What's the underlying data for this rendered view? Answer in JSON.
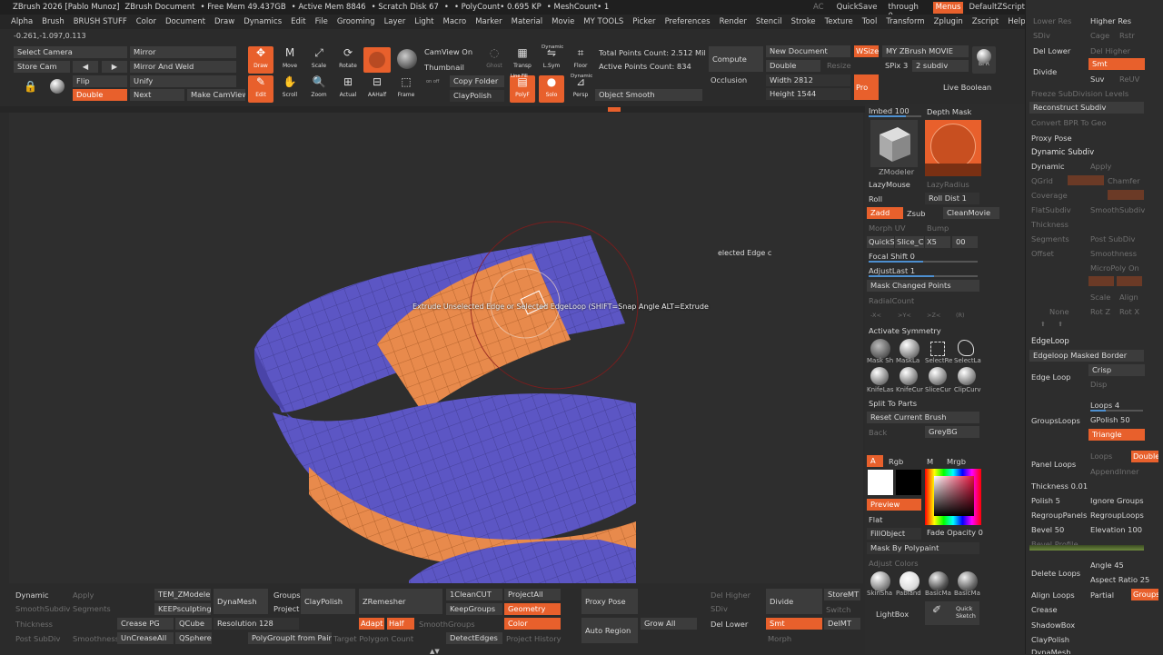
{
  "titlebar": {
    "items": [
      "ZBrush 2026 [Pablo Munoz]",
      "ZBrush Document",
      "• Free Mem 49.437GB",
      "• Active Mem 8846",
      "• Scratch Disk 67",
      "•",
      "• PolyCount• 0.695 KP",
      "• MeshCount• 1"
    ]
  },
  "top_right": {
    "ac": "AC",
    "quicksave": "QuickSave",
    "seethrough": "See-through 0",
    "menus": "Menus",
    "script": "DefaultZScript"
  },
  "menu": [
    "Alpha",
    "Brush",
    "BRUSH STUFF",
    "Color",
    "Document",
    "Draw",
    "Dynamics",
    "Edit",
    "File",
    "Grooming",
    "Layer",
    "Light",
    "Macro",
    "Marker",
    "Material",
    "Movie",
    "MY TOOLS",
    "Picker",
    "Preferences",
    "Render",
    "Stencil",
    "Stroke",
    "Texture",
    "Tool",
    "Transform",
    "Zplugin",
    "Zscript",
    "Help"
  ],
  "coords": "-0.261,-1.097,0.113",
  "toolbar": {
    "select_camera": "Select Camera",
    "mirror": "Mirror",
    "store_cam": "Store Cam",
    "mirror_weld": "Mirror And Weld",
    "flip": "Flip",
    "unify": "Unify",
    "double": "Double",
    "next": "Next",
    "make_camview": "Make CamView",
    "draw": "Draw",
    "move": "Move",
    "scale": "Scale",
    "rotate": "Rotate",
    "edit": "Edit",
    "scroll": "Scroll",
    "zoom": "Zoom",
    "actual": "Actual",
    "aahalf": "AAHalf",
    "frame": "Frame",
    "camview_on": "CamView On",
    "thumbnail": "Thumbnail",
    "copy_folder": "Copy Folder",
    "claypolish": "ClayPolish",
    "on_off": "on   off",
    "ghost": "Ghost",
    "transp": "Transp",
    "lsym": "L.Sym",
    "floor": "Floor",
    "dynamic": "Dynamic",
    "polyf": "PolyF",
    "solo": "Solo",
    "persp": "Persp",
    "linefill": "Line Fill",
    "dynamic2": "Dynamic",
    "total_points": "Total Points Count: 2.512 Mil",
    "active_points": "Active Points Count: 834",
    "object_smooth": "Object Smooth",
    "compute": "Compute",
    "occlusion": "Occlusion",
    "new_document": "New Document",
    "double2": "Double",
    "resize": "Resize",
    "width": "Width 2812",
    "height": "Height 1544",
    "wsize": "WSize",
    "pro": "Pro",
    "my_zbrush_movie": "MY ZBrush MOVIE",
    "spix": "SPix 3",
    "subdiv": "2 subdiv",
    "bpr": "BPR",
    "live_boolean": "Live Boolean"
  },
  "viewport": {
    "tooltip": "Extrude Unselected Edge or Selected EdgeLoop (SHIFT=Snap Angle  ALT=Extrude",
    "side_text": "elected Edge c"
  },
  "rpanel": {
    "imbed": "Imbed 100",
    "depth_mask": "Depth Mask",
    "zmodeler": "ZModeler",
    "lazymouse": "LazyMouse",
    "lazyradius": "LazyRadius",
    "roll": "Roll",
    "roll_dist": "Roll Dist 1",
    "zadd": "Zadd",
    "zsub": "Zsub",
    "cleanmovie": "CleanMovie",
    "morph_uv": "Morph UV",
    "bump": "Bump",
    "quicksc": "QuickSc",
    "slice": "Slice_Cu",
    "x5": "X5",
    "oo": "00",
    "focal_shift": "Focal Shift 0",
    "adjustlast": "AdjustLast 1",
    "mask_changed": "Mask Changed Points",
    "radialcount": "RadialCount",
    "axes": [
      "-X<",
      ">Y<",
      ">Z<",
      "(R)"
    ],
    "activate_symmetry": "Activate Symmetry",
    "brush_labels": [
      "Mask Sh",
      "MaskLa",
      "SelectRe",
      "SelectLa"
    ],
    "brush_labels2": [
      "KnifeLas",
      "KnifeCur",
      "SliceCur",
      "ClipCurv"
    ],
    "split_to_parts": "Split To Parts",
    "reset_brush": "Reset Current Brush",
    "back": "Back",
    "greybg": "GreyBG",
    "a": "A",
    "rgb": "Rgb",
    "m": "M",
    "mrgb": "Mrgb",
    "preview": "Preview",
    "flat": "Flat",
    "fillobject": "FillObject",
    "fade_opacity": "Fade Opacity 0",
    "mask_polypaint": "Mask By Polypaint",
    "adjust_colors": "Adjust Colors",
    "mat_labels": [
      "SkinSha",
      "Pabland",
      "BasicMa",
      "BasicMa"
    ],
    "lightbox": "LightBox",
    "quick_sketch": "Quick Sketch"
  },
  "bottom": {
    "dynamic": "Dynamic",
    "apply": "Apply",
    "smoothsubdiv": "SmoothSubdiv",
    "segments": "Segments",
    "thickness": "Thickness",
    "post_subdiv": "Post SubDiv",
    "smoothness": "Smoothness",
    "tem_zmodeler": "TEM_ZModeler",
    "keepsculpting": "KEEPsculpting",
    "crease_pg": "Crease PG",
    "qcube": "QCube",
    "uncreaseall": "UnCreaseAll",
    "qsphere": "QSphere",
    "dynamesh": "DynaMesh",
    "resolution": "Resolution 128",
    "groups": "Groups",
    "project": "Project",
    "claypolish": "ClayPolish",
    "polygroupit": "PolyGroupIt from Paint",
    "zremesher": "ZRemesher",
    "adapt": "Adapt",
    "half": "Half",
    "smoothgroups": "SmoothGroups",
    "target_poly": "Target Polygon Count",
    "cleancut": "1CleanCUT",
    "keepgroups": "KeepGroups",
    "detectedges": "DetectEdges",
    "projectall": "ProjectAll",
    "geometry": "Geometry",
    "color": "Color",
    "project_history": "Project History",
    "proxy_pose": "Proxy Pose",
    "auto_region": "Auto Region",
    "grow_all": "Grow All",
    "del_higher": "Del Higher",
    "sdiv": "SDiv",
    "del_lower": "Del Lower",
    "divide": "Divide",
    "smt": "Smt",
    "storemt": "StoreMT",
    "switch": "Switch",
    "delmt": "DelMT",
    "morph": "Morph"
  },
  "farright": {
    "lower_res": "Lower Res",
    "higher_res": "Higher Res",
    "sdiv": "SDiv",
    "cage": "Cage",
    "rstr": "Rstr",
    "del_lower": "Del Lower",
    "del_higher": "Del Higher",
    "divide": "Divide",
    "smt": "Smt",
    "suv": "Suv",
    "reuv": "ReUV",
    "freeze": "Freeze SubDivision Levels",
    "reconstruct": "Reconstruct Subdiv",
    "convert_bpr": "Convert BPR To Geo",
    "proxy_pose": "Proxy Pose",
    "dynamic_subdiv": "Dynamic Subdiv",
    "dynamic": "Dynamic",
    "apply": "Apply",
    "qgrid": "QGrid",
    "chamfer": "Chamfer",
    "coverage": "Coverage",
    "flatsubdiv": "FlatSubdiv",
    "smoothsubdiv": "SmoothSubdiv",
    "thickness": "Thickness",
    "segments": "Segments",
    "post_subdiv": "Post SubDiv",
    "offset": "Offset",
    "smoothness": "Smoothness",
    "micropoly": "MicroPoly On",
    "scale": "Scale",
    "align": "Align",
    "none": "None",
    "rot_z": "Rot Z",
    "rot_x": "Rot X",
    "edgeloop": "EdgeLoop",
    "edgeloop_masked": "Edgeloop Masked Border",
    "edge_loop": "Edge Loop",
    "crisp": "Crisp",
    "disp": "Disp",
    "groupsloops": "GroupsLoops",
    "loops": "Loops 4",
    "gpolish": "GPolish 50",
    "triangle": "Triangle",
    "panel_loops": "Panel Loops",
    "loops2": "Loops",
    "double": "Double",
    "append": "Append",
    "inner": "Inner",
    "thickness_val": "Thickness 0.01",
    "polish": "Polish 5",
    "ignore_groups": "Ignore Groups",
    "regrouppanels": "RegroupPanels",
    "regrouploops": "RegroupLoops",
    "bevel": "Bevel 50",
    "elevation": "Elevation 100",
    "bevel_profile": "Bevel Profile",
    "delete_loops": "Delete Loops",
    "angle": "Angle 45",
    "aspect_ratio": "Aspect Ratio 25",
    "align_loops": "Align Loops",
    "partial": "Partial",
    "groups": "Groups",
    "crease": "Crease",
    "shadowbox": "ShadowBox",
    "claypolish": "ClayPolish",
    "dynamesh": "DynaMesh"
  },
  "colors": {
    "accent": "#e8602c",
    "blue": "#5c56c4",
    "orange_mesh": "#e88a4c"
  }
}
